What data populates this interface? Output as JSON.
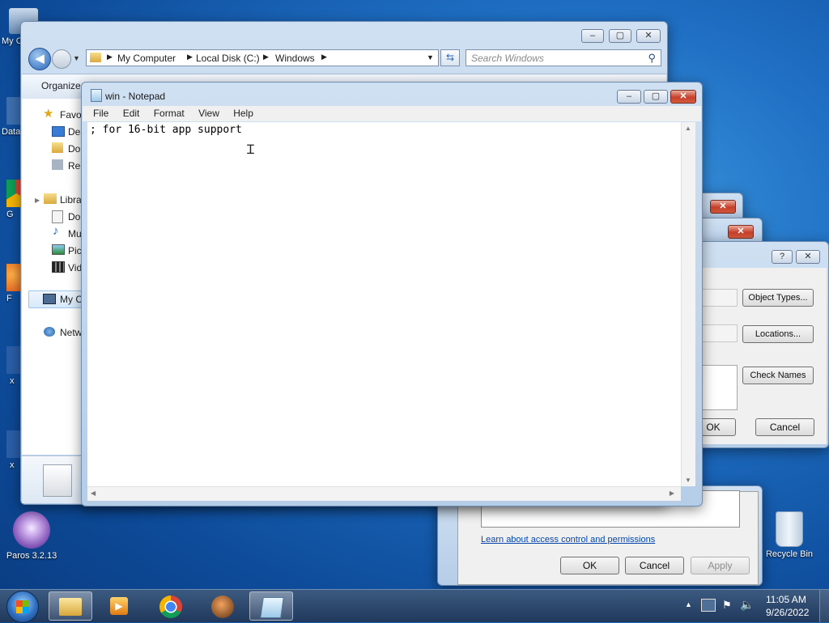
{
  "desktop": {
    "icons": [
      {
        "label": "My C"
      },
      {
        "label": "Data"
      },
      {
        "label": "G"
      },
      {
        "label": "F"
      },
      {
        "label": "x"
      },
      {
        "label": "x"
      },
      {
        "label": "Paros 3.2.13"
      },
      {
        "label": "Recycle Bin"
      }
    ]
  },
  "explorer": {
    "breadcrumb": [
      "My Computer",
      "Local Disk (C:)",
      "Windows"
    ],
    "search_placeholder": "Search Windows",
    "organize_label": "Organize",
    "nav": {
      "favorites": "Favo",
      "fav_items": [
        "Des",
        "Do",
        "Rec"
      ],
      "libraries": "Libra",
      "lib_items": [
        "Do",
        "Mu",
        "Pic",
        "Vid"
      ],
      "computer": "My C",
      "network": "Netw"
    }
  },
  "notepad": {
    "title": "win - Notepad",
    "menu": [
      "File",
      "Edit",
      "Format",
      "View",
      "Help"
    ],
    "content": "; for 16-bit app support"
  },
  "select_dialog": {
    "buttons": {
      "object_types": "Object Types...",
      "locations": "Locations...",
      "check_names": "Check Names",
      "ok": "OK",
      "cancel": "Cancel"
    },
    "help_glyph": "?",
    "close_glyph": "✕"
  },
  "permissions_dialog": {
    "link": "Learn about access control and permissions",
    "ok": "OK",
    "cancel": "Cancel",
    "apply": "Apply"
  },
  "taskbar": {
    "time": "11:05 AM",
    "date": "9/26/2022"
  }
}
